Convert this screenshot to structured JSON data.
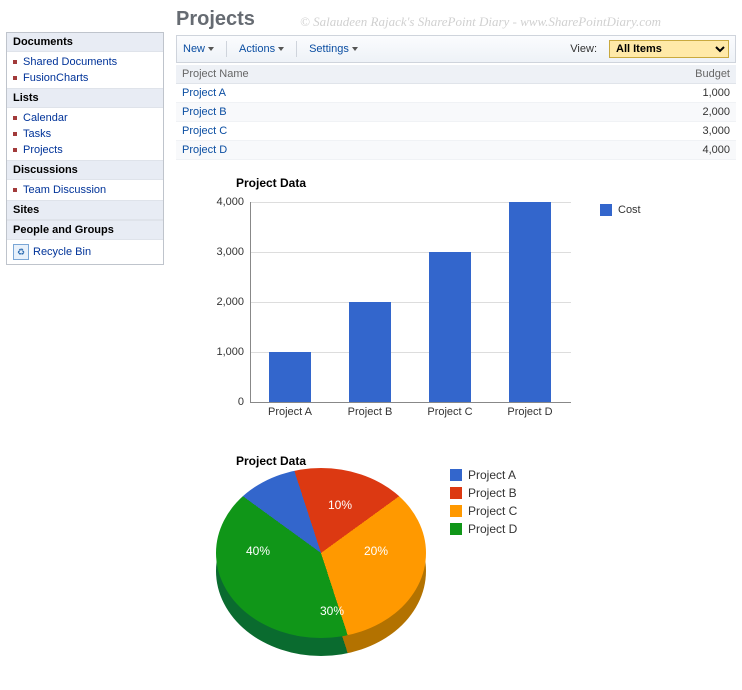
{
  "watermark": "© Salaudeen Rajack's SharePoint Diary - www.SharePointDiary.com",
  "page_title": "Projects",
  "leftnav": {
    "sections": [
      {
        "title": "Documents",
        "items": [
          "Shared Documents",
          "FusionCharts"
        ]
      },
      {
        "title": "Lists",
        "items": [
          "Calendar",
          "Tasks",
          "Projects"
        ]
      },
      {
        "title": "Discussions",
        "items": [
          "Team Discussion"
        ]
      },
      {
        "title": "Sites",
        "items": []
      },
      {
        "title": "People and Groups",
        "items": []
      }
    ],
    "recycle_label": "Recycle Bin"
  },
  "toolbar": {
    "new_label": "New",
    "actions_label": "Actions",
    "settings_label": "Settings",
    "view_label": "View:",
    "view_selected": "All Items"
  },
  "table": {
    "columns": [
      "Project Name",
      "Budget"
    ],
    "rows": [
      {
        "name": "Project A",
        "budget": "1,000"
      },
      {
        "name": "Project B",
        "budget": "2,000"
      },
      {
        "name": "Project C",
        "budget": "3,000"
      },
      {
        "name": "Project D",
        "budget": "4,000"
      }
    ]
  },
  "chart_data": [
    {
      "type": "bar",
      "title": "Project Data",
      "categories": [
        "Project A",
        "Project B",
        "Project C",
        "Project D"
      ],
      "values": [
        1000,
        2000,
        3000,
        4000
      ],
      "series_name": "Cost",
      "ylim": [
        0,
        4000
      ],
      "yticks": [
        0,
        1000,
        2000,
        3000,
        4000
      ],
      "ytick_labels": [
        "0",
        "1,000",
        "2,000",
        "3,000",
        "4,000"
      ],
      "colors": {
        "bar": "#3366cc"
      }
    },
    {
      "type": "pie",
      "title": "Project Data",
      "slices": [
        {
          "label": "Project A",
          "value": 10,
          "display": "10%",
          "color": "#3366cc"
        },
        {
          "label": "Project B",
          "value": 20,
          "display": "20%",
          "color": "#dc3912"
        },
        {
          "label": "Project C",
          "value": 30,
          "display": "30%",
          "color": "#ff9900"
        },
        {
          "label": "Project D",
          "value": 40,
          "display": "40%",
          "color": "#109618"
        }
      ]
    }
  ]
}
